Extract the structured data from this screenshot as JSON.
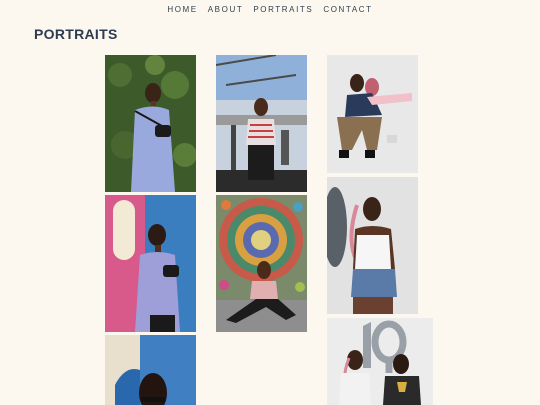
{
  "nav": {
    "items": [
      {
        "label": "HOME"
      },
      {
        "label": "ABOUT"
      },
      {
        "label": "PORTRAITS"
      },
      {
        "label": "CONTACT"
      }
    ]
  },
  "page": {
    "title": "PORTRAITS"
  },
  "gallery": {
    "photos": [
      {
        "subject": "woman in lilac top with belt bag against green hedge"
      },
      {
        "subject": "woman in striped top on rooftop terrace"
      },
      {
        "subject": "two women posing together against white wall"
      },
      {
        "subject": "woman in lilac top against pink and blue mural"
      },
      {
        "subject": "woman sitting in front of colorful dotted mandala mural"
      },
      {
        "subject": "woman in white tank top and denim shorts with balloon"
      },
      {
        "subject": "woman with sunglasses against blue painted wall"
      },
      {
        "subject": "two women with silver number 19 balloons"
      }
    ]
  },
  "colors": {
    "background": "#fdf8ef",
    "text": "#2d3c4f"
  }
}
